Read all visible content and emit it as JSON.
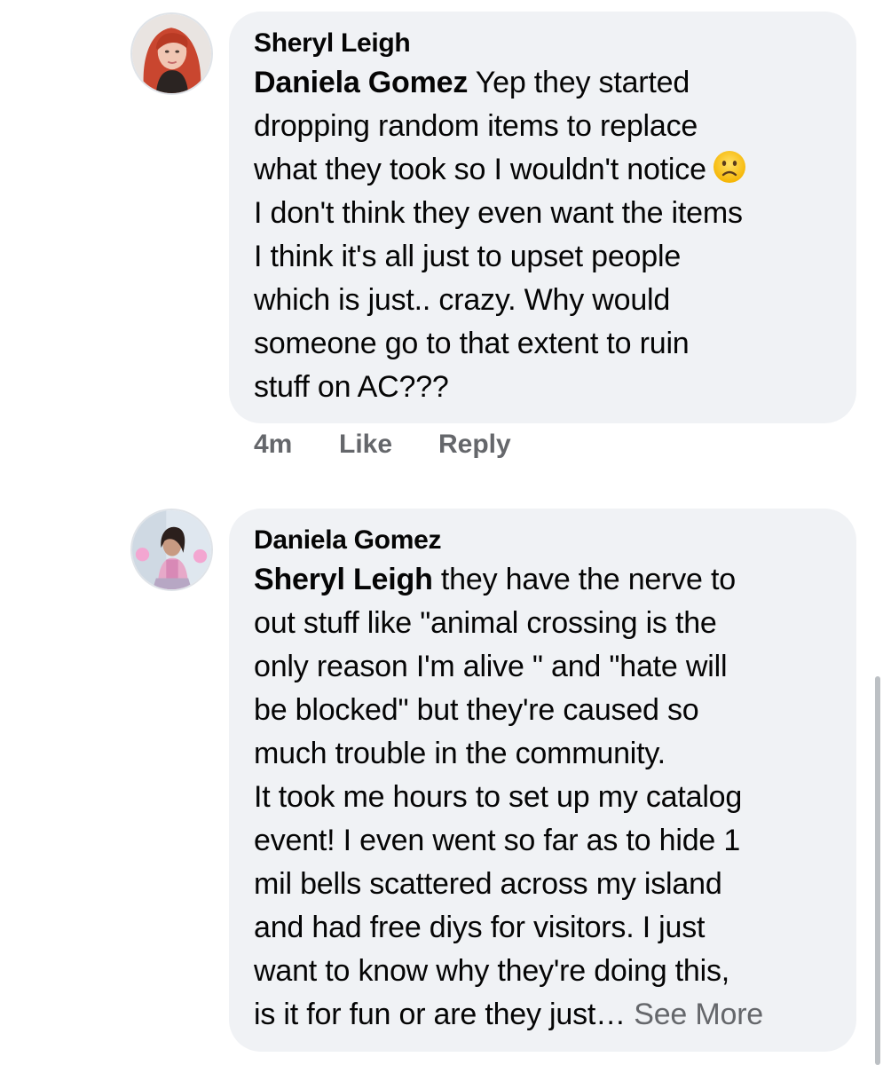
{
  "comments": [
    {
      "author": "Sheryl Leigh",
      "mention": "Daniela Gomez",
      "lines": [
        " Yep they started",
        "dropping random items to replace",
        "what they took so I wouldn't notice",
        "I don't think they even want the items",
        "I think it's all just to upset people",
        "which is just.. crazy. Why would",
        "someone go to that extent to ruin",
        "stuff on AC???"
      ],
      "emoji": "frowning-face-emoji",
      "time": "4m",
      "like_label": "Like",
      "reply_label": "Reply"
    },
    {
      "author": "Daniela Gomez",
      "mention": "Sheryl Leigh",
      "lines": [
        " they have the nerve to",
        "out stuff like \"animal crossing is the",
        "only reason I'm alive \" and \"hate will",
        "be blocked\" but they're caused so",
        "much trouble in the community.",
        "It took me hours to set up my catalog",
        "event! I even went so far as to hide 1",
        "mil bells scattered across my island",
        "and had free diys for visitors. I just",
        "want to know why they're doing this,",
        "is it for fun or are they just…"
      ],
      "see_more": " See More"
    }
  ],
  "colors": {
    "bubble": "#f0f2f5",
    "text": "#050505",
    "secondary": "#65676b"
  }
}
